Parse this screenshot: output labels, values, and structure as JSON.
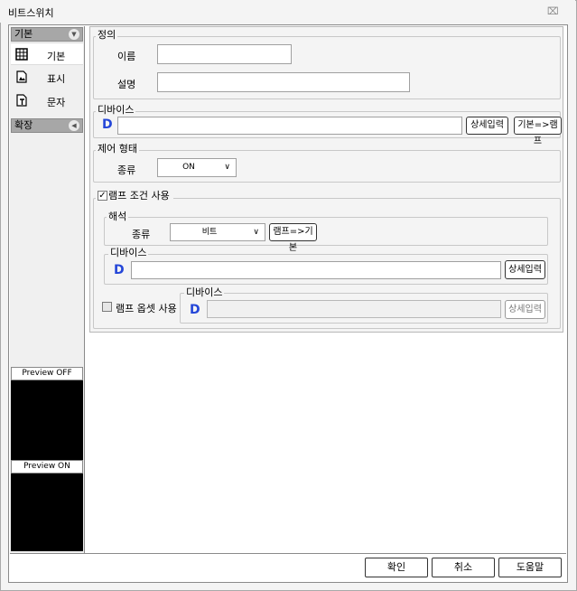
{
  "window": {
    "title": "비트스위치",
    "close_glyph": "⌧"
  },
  "sidebar": {
    "basic_header": "기본",
    "basic_items": [
      {
        "label": "기본",
        "icon": "grid-icon"
      },
      {
        "label": "표시",
        "icon": "image-file-icon"
      },
      {
        "label": "문자",
        "icon": "text-file-icon"
      }
    ],
    "extend_header": "확장",
    "preview_off": "Preview OFF",
    "preview_on": "Preview ON"
  },
  "definition": {
    "legend": "정의",
    "name_label": "이름",
    "name_value": "",
    "desc_label": "설명",
    "desc_value": ""
  },
  "device1": {
    "legend": "디바이스",
    "d_glyph": "D",
    "value": "",
    "detail_button": "상세입력",
    "copy_button": "기본=>램프"
  },
  "control": {
    "legend": "제어 형태",
    "type_label": "종류",
    "type_value": "ON"
  },
  "lamp": {
    "use_label": "램프 조건 사용",
    "use_checked": true,
    "interpret": {
      "legend": "해석",
      "type_label": "종류",
      "type_value": "비트",
      "copy_button": "램프=>기본"
    },
    "device": {
      "legend": "디바이스",
      "d_glyph": "D",
      "value": "",
      "detail_button": "상세입력"
    },
    "offset": {
      "use_label": "램프 옵셋 사용",
      "use_checked": false,
      "legend": "디바이스",
      "d_glyph": "D",
      "value": "",
      "detail_button": "상세입력"
    }
  },
  "footer": {
    "ok": "확인",
    "cancel": "취소",
    "help": "도움말"
  }
}
